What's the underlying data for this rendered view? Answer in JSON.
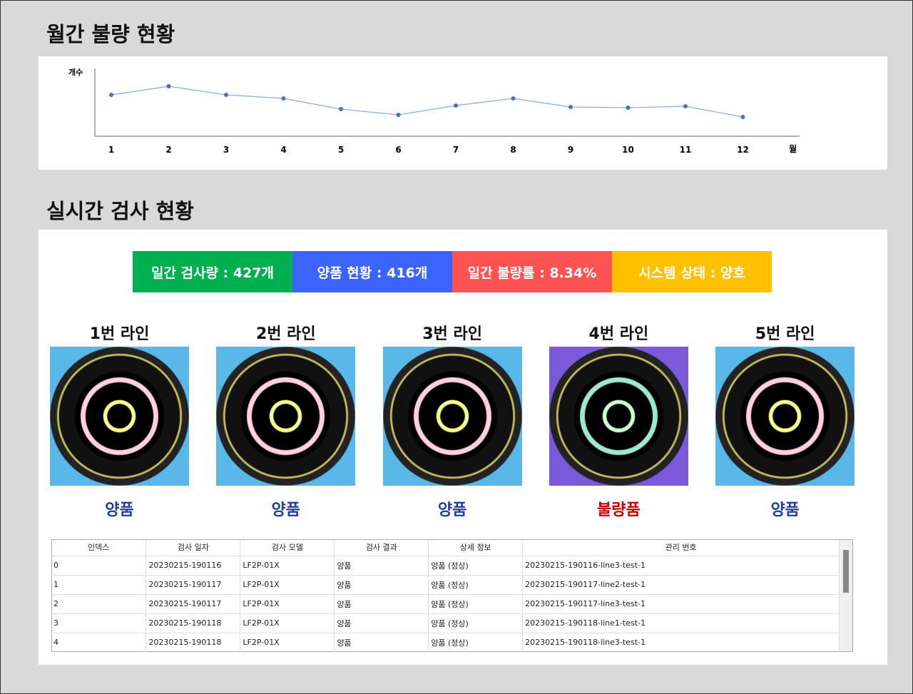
{
  "monthly": {
    "title": "월간 불량 현황"
  },
  "chart_data": {
    "type": "line",
    "title": "월간 불량 현황",
    "ylabel": "개수",
    "xlabel": "월",
    "categories": [
      "1",
      "2",
      "3",
      "4",
      "5",
      "6",
      "7",
      "8",
      "9",
      "10",
      "11",
      "12"
    ],
    "values": [
      58,
      70,
      58,
      53,
      38,
      30,
      43,
      53,
      41,
      40,
      42,
      27
    ],
    "ylim": [
      0,
      95
    ],
    "color": "#4472c4"
  },
  "realtime": {
    "title": "실시간 검사 현황",
    "status": [
      {
        "label": "일간 검사량 : 427개",
        "color": "#00b050"
      },
      {
        "label": "양품 현황 : 416개",
        "color": "#3d63ff"
      },
      {
        "label": "일간 불량률 : 8.34%",
        "color": "#ff5353"
      },
      {
        "label": "시스템 상태 : 양호",
        "color": "#ffc000"
      }
    ],
    "lines": [
      {
        "name": "1번 라인",
        "result": "양품",
        "color": "#1f3f9a",
        "defect": false
      },
      {
        "name": "2번 라인",
        "result": "양품",
        "color": "#1f3f9a",
        "defect": false
      },
      {
        "name": "3번 라인",
        "result": "양품",
        "color": "#1f3f9a",
        "defect": false
      },
      {
        "name": "4번 라인",
        "result": "불량품",
        "color": "#c00000",
        "defect": true
      },
      {
        "name": "5번 라인",
        "result": "양품",
        "color": "#1f3f9a",
        "defect": false
      }
    ]
  },
  "table": {
    "headers": [
      "인덱스",
      "검사 일자",
      "검사 모델",
      "검사 결과",
      "상세 정보",
      "관리 번호"
    ],
    "rows": [
      [
        "0",
        "20230215-190116",
        "LF2P-01X",
        "양품",
        "양품 (정상)",
        "20230215-190116-line3-test-1"
      ],
      [
        "1",
        "20230215-190117",
        "LF2P-01X",
        "양품",
        "양품 (정상)",
        "20230215-190117-line2-test-1"
      ],
      [
        "2",
        "20230215-190117",
        "LF2P-01X",
        "양품",
        "양품 (정상)",
        "20230215-190117-line3-test-1"
      ],
      [
        "3",
        "20230215-190118",
        "LF2P-01X",
        "양품",
        "양품 (정상)",
        "20230215-190118-line1-test-1"
      ],
      [
        "4",
        "20230215-190118",
        "LF2P-01X",
        "양품",
        "양품 (정상)",
        "20230215-190118-line3-test-1"
      ]
    ]
  }
}
